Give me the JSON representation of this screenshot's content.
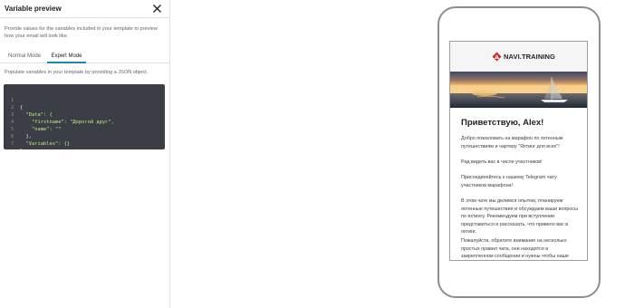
{
  "panel": {
    "title": "Variable preview",
    "description": "Provide values for the variables included in your template to preview how your email will look like.",
    "tabs": [
      {
        "label": "Normal Mode",
        "active": false
      },
      {
        "label": "Expert Mode",
        "active": true
      }
    ],
    "populate_text": "Populate variables in your template by providing a JSON object.",
    "accent_color": "#1e88a8"
  },
  "editor": {
    "lines": [
      {
        "num": "1",
        "text": "{"
      },
      {
        "num": "2",
        "text": "  \"Data\": {"
      },
      {
        "num": "3",
        "text": "    \"firstname\": \"Дорогой друг\","
      },
      {
        "num": "4",
        "text": "    \"name\": \"\""
      },
      {
        "num": "5",
        "text": "  },"
      },
      {
        "num": "6",
        "text": "  \"Variables\": {}"
      },
      {
        "num": "7",
        "text": "}"
      }
    ]
  },
  "email": {
    "brand": "NAVI.TRAINING",
    "greeting": "Приветствую, Alex!",
    "paragraphs": [
      "Добро пожаловать на марафон по яхтенным путешествиям и чартеру \"Яхтинг для всех\"!",
      "Рад видеть вас в числе участников!",
      "Присоединяйтесь к нашему Telegram чату участников марафона!",
      "В этом чате мы делимся опытом, планируем яхтенные путешествия и обсуждаем ваши вопросы по яхтингу. Рекомендуем при вступлении представиться и рассказать, что привело вас в яхтинг.",
      "Пожалуйста, обратите внимание на несколько простых правил чата, они находятся в закрепленном сообщении и нужны чтобы наше"
    ]
  }
}
